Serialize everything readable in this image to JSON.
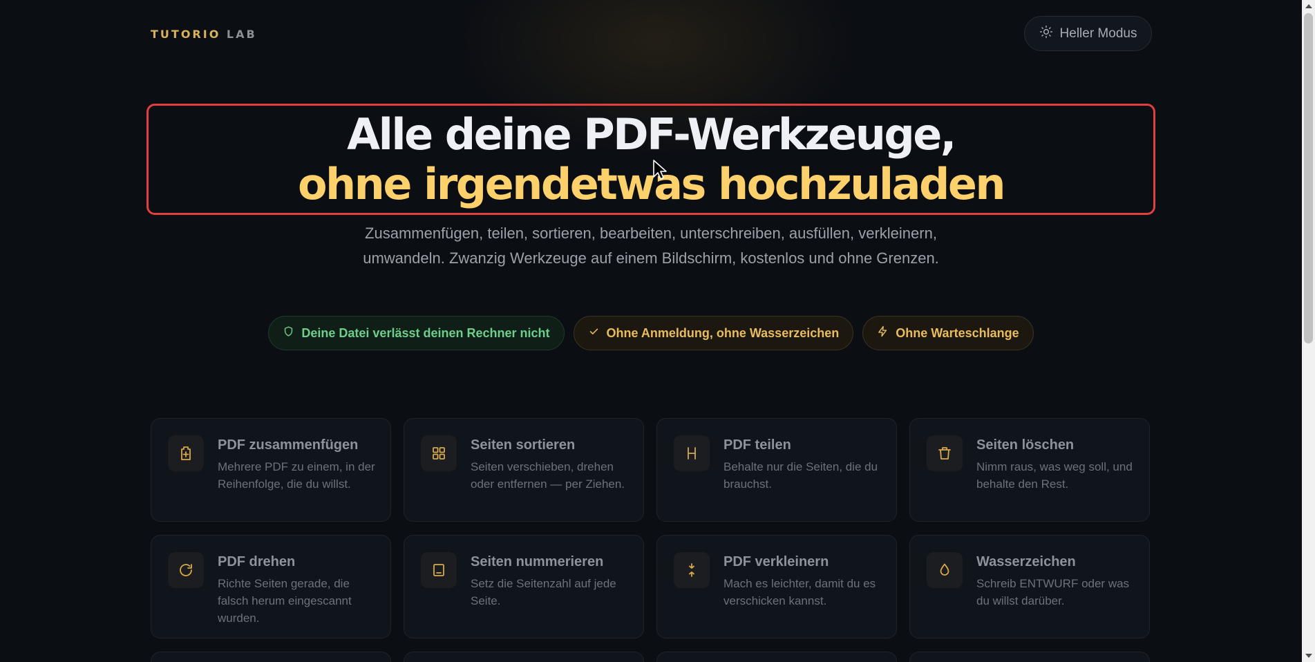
{
  "header": {
    "logo_main": "TUTORIO",
    "logo_lab": "LAB",
    "mode_toggle_label": "Heller Modus"
  },
  "hero": {
    "title_line1": "Alle deine PDF-Werkzeuge,",
    "title_line2": "ohne irgendetwas hochzuladen",
    "subtitle": "Zusammenfügen, teilen, sortieren, bearbeiten, unterschreiben, ausfüllen, verkleinern, umwandeln. Zwanzig Werkzeuge auf einem Bildschirm, kostenlos und ohne Grenzen."
  },
  "badges": [
    {
      "label": "Deine Datei verlässt deinen Rechner nicht",
      "icon": "shield-icon"
    },
    {
      "label": "Ohne Anmeldung, ohne Wasserzeichen",
      "icon": "check-icon"
    },
    {
      "label": "Ohne Warteschlange",
      "icon": "bolt-icon"
    }
  ],
  "tools": [
    {
      "title": "PDF zusammenfügen",
      "desc": "Mehrere PDF zu einem, in der Reihenfolge, die du willst.",
      "icon": "merge-icon"
    },
    {
      "title": "Seiten sortieren",
      "desc": "Seiten verschieben, drehen oder entfernen — per Ziehen.",
      "icon": "grid-icon"
    },
    {
      "title": "PDF teilen",
      "desc": "Behalte nur die Seiten, die du brauchst.",
      "icon": "split-icon"
    },
    {
      "title": "Seiten löschen",
      "desc": "Nimm raus, was weg soll, und behalte den Rest.",
      "icon": "trash-icon"
    },
    {
      "title": "PDF drehen",
      "desc": "Richte Seiten gerade, die falsch herum eingescannt wurden.",
      "icon": "rotate-icon"
    },
    {
      "title": "Seiten nummerieren",
      "desc": "Setz die Seitenzahl auf jede Seite.",
      "icon": "page-number-icon"
    },
    {
      "title": "PDF verkleinern",
      "desc": "Mach es leichter, damit du es verschicken kannst.",
      "icon": "compress-icon"
    },
    {
      "title": "Wasserzeichen",
      "desc": "Schreib ENTWURF oder was du willst darüber.",
      "icon": "droplet-icon"
    }
  ],
  "colors": {
    "background": "#0b0e13",
    "accent": "#fcd06b",
    "highlight_border": "#e2403e",
    "green": "#6dcf8b"
  }
}
